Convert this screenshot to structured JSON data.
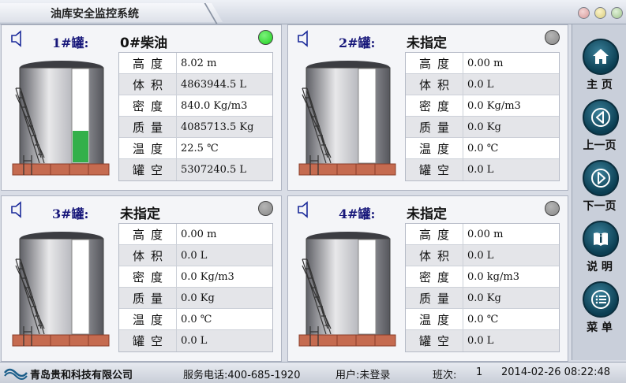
{
  "app": {
    "title": "油库安全监控系统"
  },
  "colors": {
    "led_green": "#1fd01f",
    "led_gray": "#888888",
    "oil_green": "#33b04a",
    "nav_blue": "#0b3e52"
  },
  "tanks": [
    {
      "name": "1#罐:",
      "oil": "0#柴油",
      "status": "green",
      "fill_ratio": 0.34,
      "rows": [
        {
          "label": "高度",
          "value": "8.02 m"
        },
        {
          "label": "体积",
          "value": "4863944.5 L"
        },
        {
          "label": "密度",
          "value": "840.0 Kg/m3"
        },
        {
          "label": "质量",
          "value": "4085713.5 Kg"
        },
        {
          "label": "温度",
          "value": "22.5 ℃"
        },
        {
          "label": "罐空",
          "value": "5307240.5 L"
        }
      ]
    },
    {
      "name": "2#罐:",
      "oil": "未指定",
      "status": "gray",
      "fill_ratio": 0,
      "rows": [
        {
          "label": "高度",
          "value": "0.00 m"
        },
        {
          "label": "体积",
          "value": "0.0 L"
        },
        {
          "label": "密度",
          "value": "0.0 Kg/m3"
        },
        {
          "label": "质量",
          "value": "0.0 Kg"
        },
        {
          "label": "温度",
          "value": "0.0 ℃"
        },
        {
          "label": "罐空",
          "value": "0.0 L"
        }
      ]
    },
    {
      "name": "3#罐:",
      "oil": "未指定",
      "status": "gray",
      "fill_ratio": 0,
      "rows": [
        {
          "label": "高度",
          "value": "0.00 m"
        },
        {
          "label": "体积",
          "value": "0.0 L"
        },
        {
          "label": "密度",
          "value": "0.0 Kg/m3"
        },
        {
          "label": "质量",
          "value": "0.0 Kg"
        },
        {
          "label": "温度",
          "value": "0.0 ℃"
        },
        {
          "label": "罐空",
          "value": "0.0 L"
        }
      ]
    },
    {
      "name": "4#罐:",
      "oil": "未指定",
      "status": "gray",
      "fill_ratio": 0,
      "rows": [
        {
          "label": "高度",
          "value": "0.00 m"
        },
        {
          "label": "体积",
          "value": "0.0 L"
        },
        {
          "label": "密度",
          "value": "0.0 kg/m3"
        },
        {
          "label": "质量",
          "value": "0.0 Kg"
        },
        {
          "label": "温度",
          "value": "0.0 ℃"
        },
        {
          "label": "罐空",
          "value": "0.0 L"
        }
      ]
    }
  ],
  "nav": [
    {
      "label": "主 页",
      "icon": "home-icon"
    },
    {
      "label": "上一页",
      "icon": "prev-page-icon"
    },
    {
      "label": "下一页",
      "icon": "next-page-icon"
    },
    {
      "label": "说 明",
      "icon": "manual-icon"
    },
    {
      "label": "菜 单",
      "icon": "menu-icon"
    }
  ],
  "status": {
    "company": "青岛贵和科技有限公司",
    "phone": "服务电话:400-685-1920",
    "user": "用户:未登录",
    "shift_label": "班次:",
    "shift_value": "1",
    "datetime": "2014-02-26 08:22:48"
  }
}
